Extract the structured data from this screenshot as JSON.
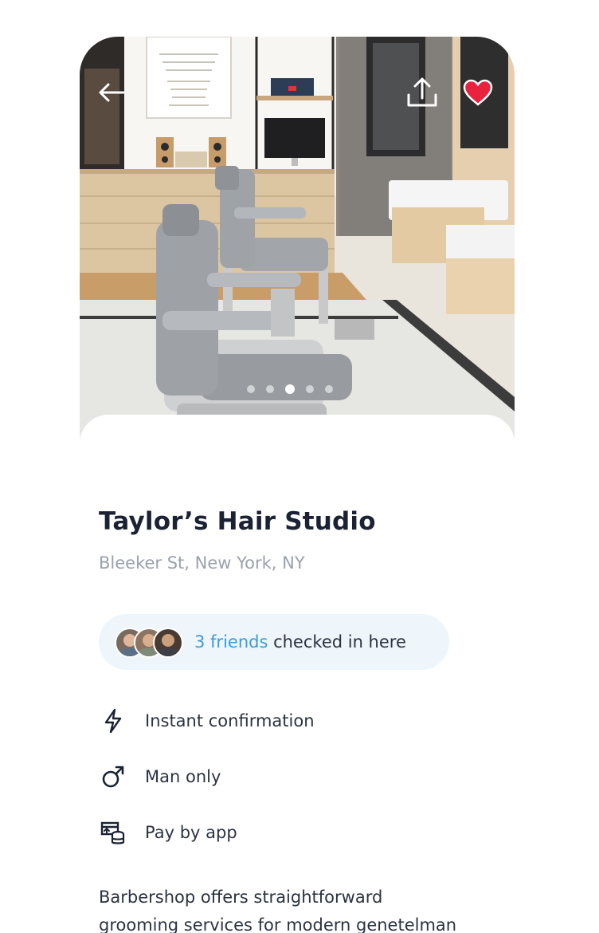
{
  "venue": {
    "name": "Taylor’s Hair Studio",
    "address": "Bleeker St, New York, NY"
  },
  "gallery": {
    "slide_count": 5,
    "active_slide": 3
  },
  "friends": {
    "count_label": "3 friends",
    "suffix": " checked in here"
  },
  "features": [
    {
      "icon": "lightning-icon",
      "label": "Instant confirmation"
    },
    {
      "icon": "male-symbol-icon",
      "label": "Man only"
    },
    {
      "icon": "pay-by-app-icon",
      "label": "Pay by app"
    }
  ],
  "description": "Barbershop offers straightforward\ngrooming services for modern genetelman\nincluding haircuts, beard trim lorem ipsu...",
  "colors": {
    "accent_blue": "#3d9bd9",
    "favorite_red": "#e8223f",
    "title_text": "#1a2233",
    "muted_text": "#9aa1ad",
    "pill_bg": "#eef5fb"
  }
}
